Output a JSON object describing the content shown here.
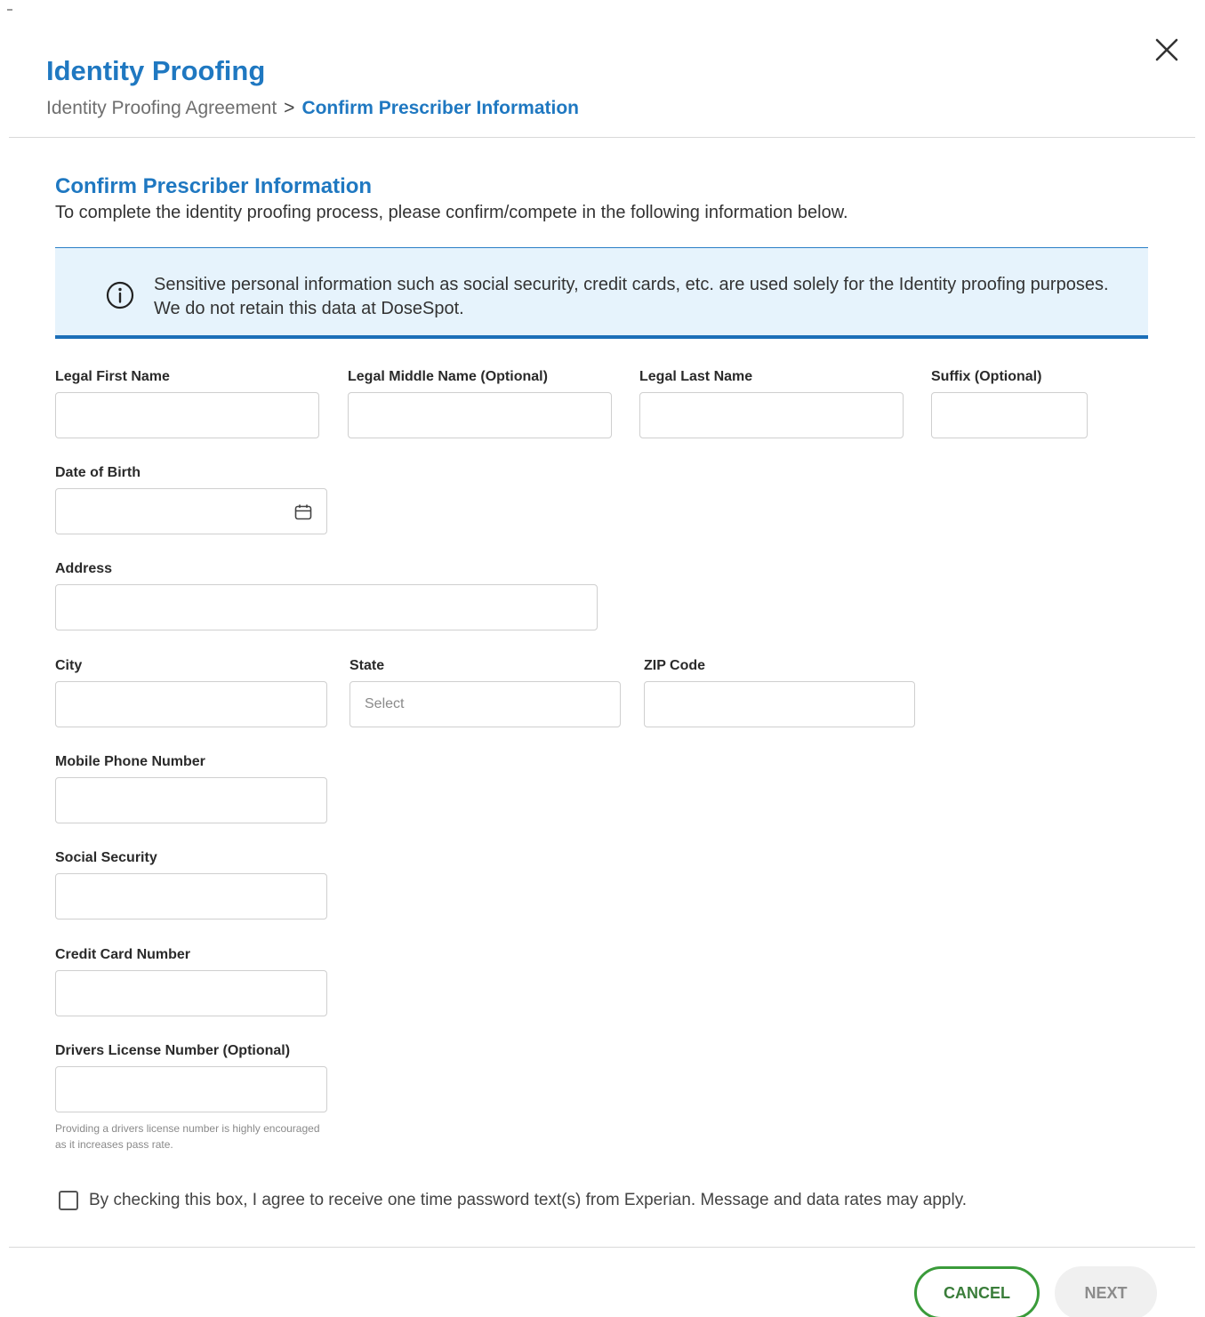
{
  "header": {
    "title": "Identity Proofing",
    "breadcrumb": {
      "step1": "Identity Proofing Agreement",
      "separator": ">",
      "current": "Confirm Prescriber Information"
    },
    "close_icon": "close-icon"
  },
  "section": {
    "title": "Confirm Prescriber Information",
    "description": "To complete the identity proofing process, please confirm/compete in the following information below."
  },
  "banner": {
    "icon": "info-icon",
    "text": "Sensitive personal information such as social security, credit cards, etc. are used solely for the Identity proofing purposes. We do not retain this data at DoseSpot."
  },
  "fields": {
    "first_name": {
      "label": "Legal First Name",
      "value": ""
    },
    "middle_name": {
      "label": "Legal Middle Name (Optional)",
      "value": ""
    },
    "last_name": {
      "label": "Legal Last Name",
      "value": ""
    },
    "suffix": {
      "label": "Suffix (Optional)",
      "value": ""
    },
    "dob": {
      "label": "Date of Birth",
      "value": "",
      "icon": "calendar-icon"
    },
    "address": {
      "label": "Address",
      "value": ""
    },
    "city": {
      "label": "City",
      "value": ""
    },
    "state": {
      "label": "State",
      "placeholder": "Select"
    },
    "zip": {
      "label": "ZIP Code",
      "value": ""
    },
    "mobile": {
      "label": "Mobile Phone Number",
      "value": ""
    },
    "ssn": {
      "label": "Social Security",
      "value": ""
    },
    "credit_card": {
      "label": "Credit Card Number",
      "value": ""
    },
    "drivers_license": {
      "label": "Drivers License Number (Optional)",
      "value": "",
      "help": "Providing a drivers license number is highly encouraged as it increases pass rate."
    }
  },
  "consent": {
    "checked": false,
    "label": "By checking this box, I agree to receive one time password text(s) from Experian. Message and data rates may apply."
  },
  "footer": {
    "cancel_label": "CANCEL",
    "next_label": "NEXT"
  },
  "colors": {
    "accent": "#1f78c1",
    "banner_bg": "#e6f3fc",
    "cancel_border": "#3a9b3a",
    "next_bg": "#f0f0f0"
  }
}
